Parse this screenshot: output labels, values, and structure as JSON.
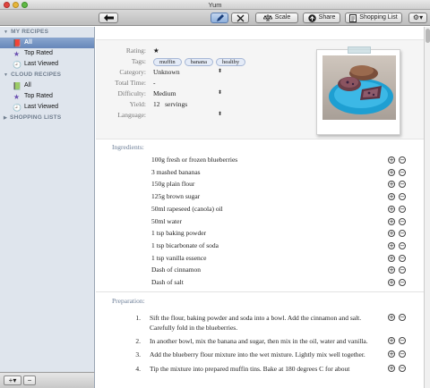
{
  "window": {
    "title": "Yum"
  },
  "toolbar": {
    "back_icon": "back-arrow-icon",
    "edit_icon": "pencil-icon",
    "tools_icon": "tools-icon",
    "scale_label": "Scale",
    "share_label": "Share",
    "shopping_list_label": "Shopping List",
    "gear_icon": "gear-icon"
  },
  "sidebar": {
    "my_recipes_header": "MY RECIPES",
    "my_recipes": [
      {
        "label": "All",
        "icon": "book-icon"
      },
      {
        "label": "Top Rated",
        "icon": "star-icon"
      },
      {
        "label": "Last Viewed",
        "icon": "clock-icon"
      }
    ],
    "cloud_recipes_header": "CLOUD RECIPES",
    "cloud_recipes": [
      {
        "label": "All",
        "icon": "book-icon"
      },
      {
        "label": "Top Rated",
        "icon": "star-icon"
      },
      {
        "label": "Last Viewed",
        "icon": "clock-icon"
      }
    ],
    "shopping_lists_header": "SHOPPING LISTS",
    "add_button": "+▾",
    "remove_button": "−"
  },
  "recipe": {
    "rating_label": "Rating:",
    "rating_value": "★",
    "tags_label": "Tags:",
    "tags": [
      "muffin",
      "banana",
      "healthy"
    ],
    "category_label": "Category:",
    "category_value": "Unknown",
    "total_time_label": "Total Time:",
    "total_time_value": "-",
    "difficulty_label": "Difficulty:",
    "difficulty_value": "Medium",
    "yield_label": "Yield:",
    "yield_value": "12",
    "yield_unit": "servings",
    "language_label": "Language:",
    "language_value": ""
  },
  "ingredients": {
    "label": "Ingredients:",
    "items": [
      "100g fresh or frozen blueberries",
      "3 mashed bananas",
      "150g plain flour",
      "125g brown sugar",
      "50ml rapeseed (canola) oil",
      "50ml water",
      "1 tsp baking powder",
      "1 tsp bicarbonate of soda",
      "1 tsp vanilla essence",
      "Dash of cinnamon",
      "Dash of salt"
    ]
  },
  "preparation": {
    "label": "Preparation:",
    "steps": [
      {
        "num": "1.",
        "text": "Sift the flour, baking powder and soda into a bowl. Add the  cinnamon and salt. Carefully fold in the blueberries."
      },
      {
        "num": "2.",
        "text": "In another bowl, mix the banana and sugar, then mix in the oil, water and vanilla."
      },
      {
        "num": "3.",
        "text": "Add the blueberry flour mixture into the wet mixture. Lightly mix well together."
      },
      {
        "num": "4.",
        "text": "Tip the mixture into prepared muffin tins. Bake at 180 degrees C for about"
      }
    ]
  },
  "colors": {
    "sidebar_bg": "#dfe5ed",
    "selection": "#6787b9",
    "section_label": "#6d7f98",
    "plate": "#2aa6d6"
  }
}
